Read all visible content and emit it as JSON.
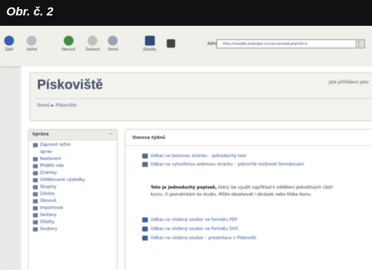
{
  "caption": {
    "text": "Obr. č. 2"
  },
  "toolbar": {
    "buttons": [
      {
        "label": "Zpět",
        "icon": "back-arrow-icon"
      },
      {
        "label": "Vpřed",
        "icon": "forward-arrow-icon"
      },
      {
        "label": "Obnovit",
        "icon": "reload-icon"
      },
      {
        "label": "Zastavit",
        "icon": "stop-icon"
      },
      {
        "label": "Domů",
        "icon": "home-icon"
      },
      {
        "label": "Záložky",
        "icon": "bookmarks-icon"
      }
    ],
    "address_label": "Adresa",
    "address_value": "http://moodle.example.cz/course/view.php?id=2"
  },
  "header": {
    "site_title": "Pískoviště",
    "login_text": "Jste přihlášeni jako",
    "breadcrumb": "Domů ► Pískoviště"
  },
  "sidebar": {
    "title": "Správa",
    "close": "−",
    "items": [
      {
        "label": "Zapnout režim"
      },
      {
        "label": "úprav"
      },
      {
        "label": "Nastavení"
      },
      {
        "label": "Přidělit role"
      },
      {
        "label": "Známky"
      },
      {
        "label": "Oddělované výsledky"
      },
      {
        "label": "Skupiny"
      },
      {
        "label": "Záloha"
      },
      {
        "label": "Obnovit"
      },
      {
        "label": "Importovat"
      },
      {
        "label": "Sestavy"
      },
      {
        "label": "Otázky"
      },
      {
        "label": "Soubory"
      }
    ]
  },
  "main": {
    "title": "Osnova týdnů",
    "resources_top": [
      "Odkaz na textovou stránku – jednoduchý text",
      "Odkaz na vytvořenou webovou stránku – pokročilé možnosti formátování"
    ],
    "para_bold": "Toto je jednoduchý popisek,",
    "para_rest": " který lze využít například k oddělení jednotlivých částí kurzu, či poznámkám ke studiu. Může obsahovat i obrázek nebo třeba ikonu.",
    "resources_bottom": [
      "Odkaz na vložený soubor ve formátu PDF",
      "Odkaz na vložený soubor ve formátu DOC",
      "Odkaz na vložený soubor – prezentace v Pískovišti"
    ]
  }
}
